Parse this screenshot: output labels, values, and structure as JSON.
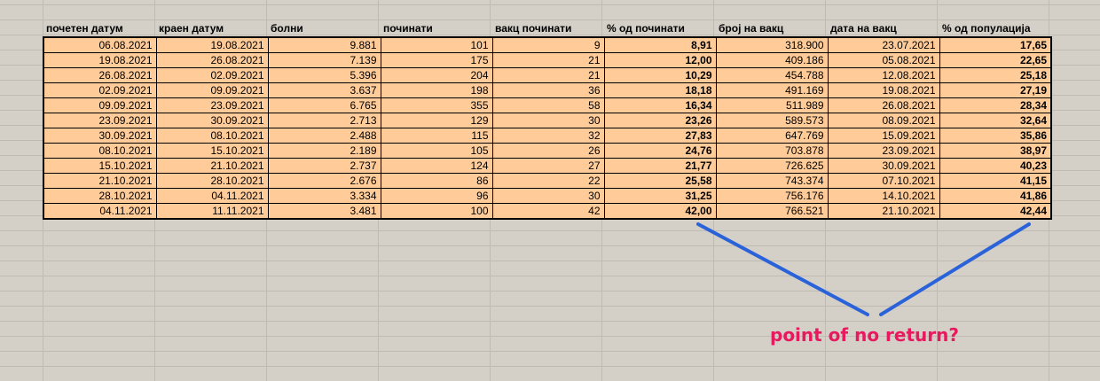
{
  "sheet": {
    "headers": [
      "почетен датум",
      "краен датум",
      "болни",
      "починати",
      "вакц починати",
      "% од починати",
      "број на вакц",
      "дата на вакц",
      "% од популација"
    ],
    "rows": [
      [
        "06.08.2021",
        "19.08.2021",
        "9.881",
        "101",
        "9",
        "8,91",
        "318.900",
        "23.07.2021",
        "17,65"
      ],
      [
        "19.08.2021",
        "26.08.2021",
        "7.139",
        "175",
        "21",
        "12,00",
        "409.186",
        "05.08.2021",
        "22,65"
      ],
      [
        "26.08.2021",
        "02.09.2021",
        "5.396",
        "204",
        "21",
        "10,29",
        "454.788",
        "12.08.2021",
        "25,18"
      ],
      [
        "02.09.2021",
        "09.09.2021",
        "3.637",
        "198",
        "36",
        "18,18",
        "491.169",
        "19.08.2021",
        "27,19"
      ],
      [
        "09.09.2021",
        "23.09.2021",
        "6.765",
        "355",
        "58",
        "16,34",
        "511.989",
        "26.08.2021",
        "28,34"
      ],
      [
        "23.09.2021",
        "30.09.2021",
        "2.713",
        "129",
        "30",
        "23,26",
        "589.573",
        "08.09.2021",
        "32,64"
      ],
      [
        "30.09.2021",
        "08.10.2021",
        "2.488",
        "115",
        "32",
        "27,83",
        "647.769",
        "15.09.2021",
        "35,86"
      ],
      [
        "08.10.2021",
        "15.10.2021",
        "2.189",
        "105",
        "26",
        "24,76",
        "703.878",
        "23.09.2021",
        "38,97"
      ],
      [
        "15.10.2021",
        "21.10.2021",
        "2.737",
        "124",
        "27",
        "21,77",
        "726.625",
        "30.09.2021",
        "40,23"
      ],
      [
        "21.10.2021",
        "28.10.2021",
        "2.676",
        "86",
        "22",
        "25,58",
        "743.374",
        "07.10.2021",
        "41,15"
      ],
      [
        "28.10.2021",
        "04.11.2021",
        "3.334",
        "96",
        "30",
        "31,25",
        "756.176",
        "14.10.2021",
        "41,86"
      ],
      [
        "04.11.2021",
        "11.11.2021",
        "3.481",
        "100",
        "42",
        "42,00",
        "766.521",
        "21.10.2021",
        "42,44"
      ]
    ],
    "bold_columns": [
      5,
      8
    ]
  },
  "annotation": {
    "text": "point of no return?",
    "text_color": "#e8195f",
    "line_color": "#2962d9"
  },
  "colors": {
    "cell_fill": "#ffcc99",
    "sheet_background": "#d4d0c8",
    "gridline": "#bfbbb3"
  }
}
